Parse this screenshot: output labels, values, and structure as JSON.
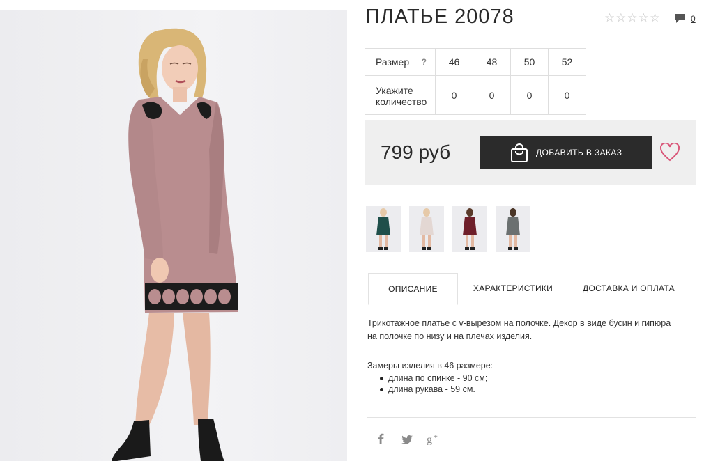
{
  "product": {
    "title": "ПЛАТЬЕ 20078",
    "rating_icon": "star-outline-icon",
    "comments_count": "0"
  },
  "size_table": {
    "size_label": "Размер",
    "help_mark": "?",
    "quantity_label_line1": "Укажите",
    "quantity_label_line2": "количество",
    "sizes": [
      "46",
      "48",
      "50",
      "52"
    ],
    "quantities": [
      "0",
      "0",
      "0",
      "0"
    ]
  },
  "purchase": {
    "price": "799 руб",
    "add_button_label": "ДОБАВИТЬ В ЗАКАЗ",
    "accent_color": "#d9587a",
    "button_color": "#2b2b2b"
  },
  "thumbnails": [
    {
      "color": "#1f4f4a"
    },
    {
      "color": "#e3d7d3"
    },
    {
      "color": "#6e1f2a"
    },
    {
      "color": "#6b7070"
    }
  ],
  "tabs": [
    {
      "label": "ОПИСАНИЕ",
      "active": true
    },
    {
      "label": "ХАРАКТЕРИСТИКИ",
      "active": false
    },
    {
      "label": "ДОСТАВКА И ОПЛАТА",
      "active": false
    }
  ],
  "description": {
    "line1": "Трикотажное платье с v-вырезом на полочке. Декор в виде бусин и гипюра",
    "line2": "на полочке по низу и на плечах изделия.",
    "measures_title": "Замеры изделия в 46 размере:",
    "measures": [
      "длина по спинке - 90 см;",
      "длина рукава - 59 см."
    ]
  },
  "social": [
    "facebook-icon",
    "twitter-icon",
    "google-plus-icon"
  ]
}
